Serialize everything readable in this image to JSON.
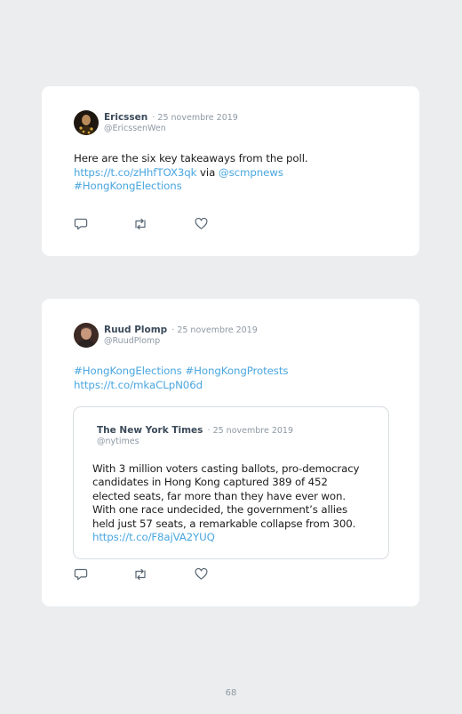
{
  "tweets": [
    {
      "author": "Ericssen",
      "date": "· 25 novembre 2019",
      "handle": "@EricssenWen",
      "text": "Here are the six key takeaways from the poll.",
      "link": "https://t.co/zHhfTOX3qk",
      "via": " via ",
      "mention": "@scmpnews",
      "hashtag": "#HongKongElections"
    },
    {
      "author": "Ruud Plomp",
      "date": "· 25 novembre 2019",
      "handle": "@RuudPlomp",
      "hashtags": "#HongKongElections #HongKongProtests",
      "link": "https://t.co/mkaCLpN06d",
      "quote": {
        "author": "The New York Times",
        "date": "· 25 novembre 2019",
        "handle": "@nytimes",
        "lines": [
          "With 3 million voters casting ballots, pro-democracy",
          "candidates in Hong Kong captured 389 of 452",
          "elected seats, far more than they have ever won.",
          "With one race undecided, the government’s allies",
          "held just 57 seats, a remarkable collapse from 300."
        ],
        "link": "https://t.co/F8ajVA2YUQ"
      }
    }
  ],
  "icons": {
    "reply": "reply-icon",
    "retweet": "retweet-icon",
    "like": "heart-icon"
  },
  "colors": {
    "background": "#ebedef",
    "card": "#ffffff",
    "link": "#4aa6e0",
    "name": "#3b4a5a",
    "muted": "#8e99a4"
  },
  "page_number": "68"
}
